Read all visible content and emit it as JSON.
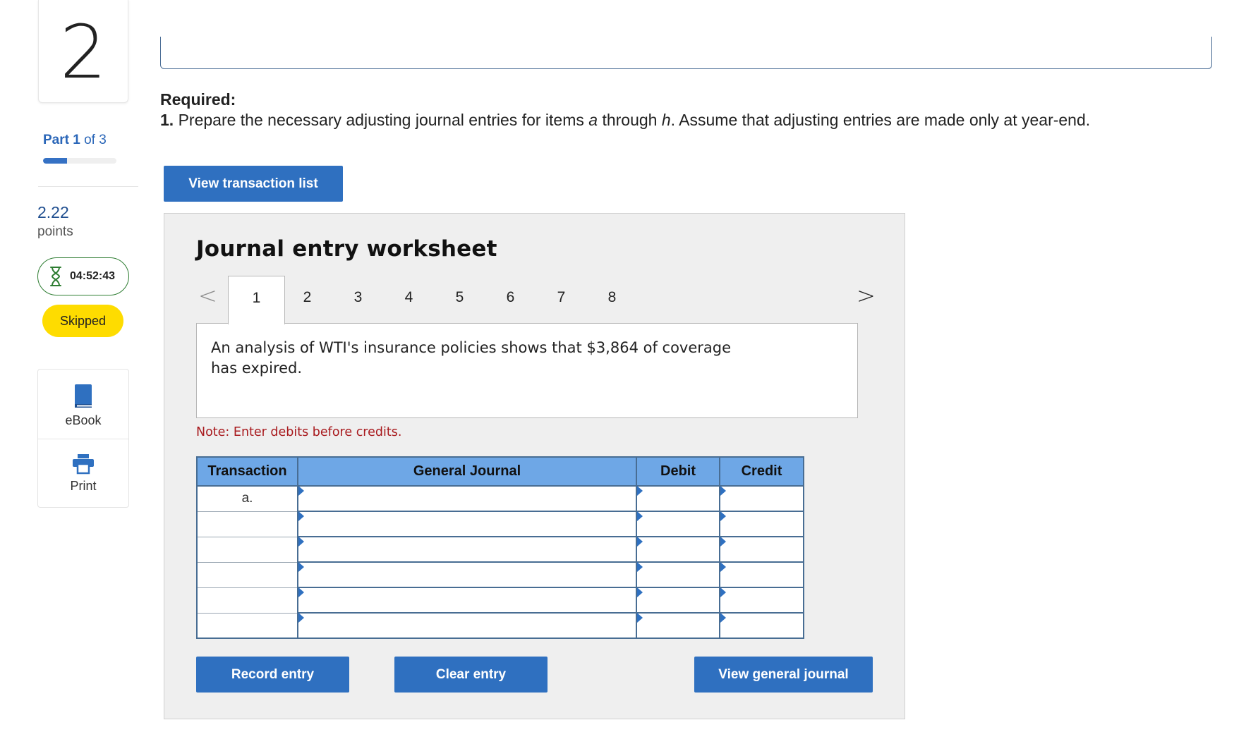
{
  "question": {
    "number": "2"
  },
  "part": {
    "prefix": "Part",
    "current": "1",
    "suffix": "of 3",
    "progress_fraction": 0.33
  },
  "points": {
    "value": "2.22",
    "label": "points"
  },
  "timer": {
    "value": "04:52:43"
  },
  "status_badge": "Skipped",
  "tools": {
    "ebook": "eBook",
    "print": "Print"
  },
  "required": {
    "heading": "Required:",
    "number": "1.",
    "text_before_a": "Prepare the necessary adjusting journal entries for items",
    "item_a": "a",
    "text_through": "through",
    "item_h": "h",
    "text_after": ". Assume that adjusting entries are made only at year-end."
  },
  "buttons": {
    "view_transaction_list": "View transaction list",
    "record_entry": "Record entry",
    "clear_entry": "Clear entry",
    "view_general_journal": "View general journal"
  },
  "worksheet": {
    "title": "Journal entry worksheet",
    "prev_symbol": "<",
    "next_symbol": ">",
    "tabs": [
      "1",
      "2",
      "3",
      "4",
      "5",
      "6",
      "7",
      "8"
    ],
    "active_tab": "1",
    "description": "An analysis of WTI's insurance policies shows that $3,864 of coverage has expired.",
    "note": "Note: Enter debits before credits."
  },
  "journal_table": {
    "headers": {
      "transaction": "Transaction",
      "general_journal": "General Journal",
      "debit": "Debit",
      "credit": "Credit"
    },
    "rows": [
      {
        "transaction": "a.",
        "account": "",
        "debit": "",
        "credit": ""
      },
      {
        "transaction": "",
        "account": "",
        "debit": "",
        "credit": ""
      },
      {
        "transaction": "",
        "account": "",
        "debit": "",
        "credit": ""
      },
      {
        "transaction": "",
        "account": "",
        "debit": "",
        "credit": ""
      },
      {
        "transaction": "",
        "account": "",
        "debit": "",
        "credit": ""
      },
      {
        "transaction": "",
        "account": "",
        "debit": "",
        "credit": ""
      }
    ]
  },
  "colors": {
    "primary_button": "#2f70c0",
    "table_header": "#6ea7e6",
    "table_border": "#486d93",
    "note_text": "#a8191d",
    "skipped_badge": "#fedc00",
    "timer_border": "#2e7d32",
    "part_link": "#2a66b8"
  }
}
